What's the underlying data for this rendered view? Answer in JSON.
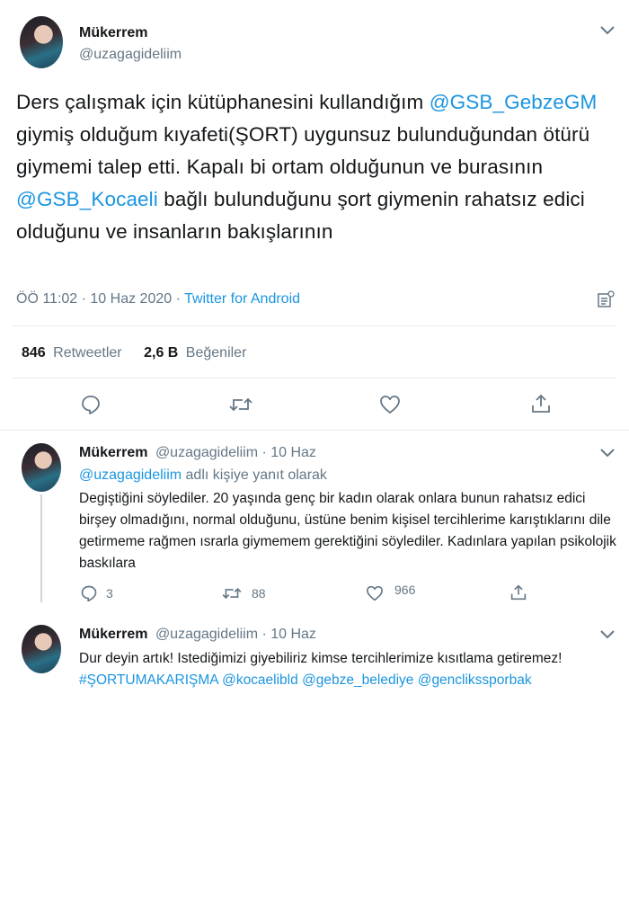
{
  "main_tweet": {
    "author_name": "Mükerrem",
    "author_handle": "@uzagagideliim",
    "text_parts": {
      "p1": "Ders çalışmak için kütüphanesini kullandığım ",
      "mention1": "@GSB_GebzeGM",
      "p2": " giymiş olduğum kıyafeti(ŞORT) uygunsuz bulunduğundan ötürü giymemi talep etti. Kapalı bi ortam olduğunun ve burasının ",
      "mention2": "@GSB_Kocaeli",
      "p3": " bağlı bulunduğunu şort giymenin rahatsız edici olduğunu ve insanların bakışlarının"
    },
    "time": "ÖÖ 11:02 · 10 Haz 2020 · ",
    "source": "Twitter for Android",
    "retweets_count": "846",
    "retweets_label": "Retweetler",
    "likes_count": "2,6 B",
    "likes_label": "Beğeniler"
  },
  "replies": [
    {
      "author_name": "Mükerrem",
      "author_handle": "@uzagagideliim · 10 Haz",
      "replying_mention": "@uzagagideliim",
      "replying_suffix": " adlı kişiye yanıt olarak",
      "text": "Degiştiğini söylediler. 20 yaşında genç bir kadın olarak onlara bunun rahatsız edici birşey olmadığını, normal olduğunu, üstüne benim kişisel tercihlerime karıştıklarını dile getirmeme rağmen ısrarla giymemem gerektiğini söylediler. Kadınlara yapılan psikolojik baskılara",
      "reply_count": "3",
      "retweet_count": "88",
      "like_count": "966"
    },
    {
      "author_name": "Mükerrem",
      "author_handle": "@uzagagideliim · 10 Haz",
      "text_start": "Dur deyin artık! Istediğimizi giyebiliriz kimse tercihlerimize kısıtlama getiremez! ",
      "hashtag": "#ŞORTUMAKARIŞMA",
      "mention_a": "@kocaelibld",
      "mention_b": "@gebze_belediye",
      "mention_c": "@genclikssporbak"
    }
  ],
  "icons": {
    "more": "chevron-down-icon",
    "reply": "reply-icon",
    "retweet": "retweet-icon",
    "like": "heart-icon",
    "share": "share-icon",
    "analytics": "analytics-icon"
  },
  "colors": {
    "link": "#1b95e0",
    "text": "#14171a",
    "muted": "#657786",
    "divider": "#e6ecf0"
  }
}
